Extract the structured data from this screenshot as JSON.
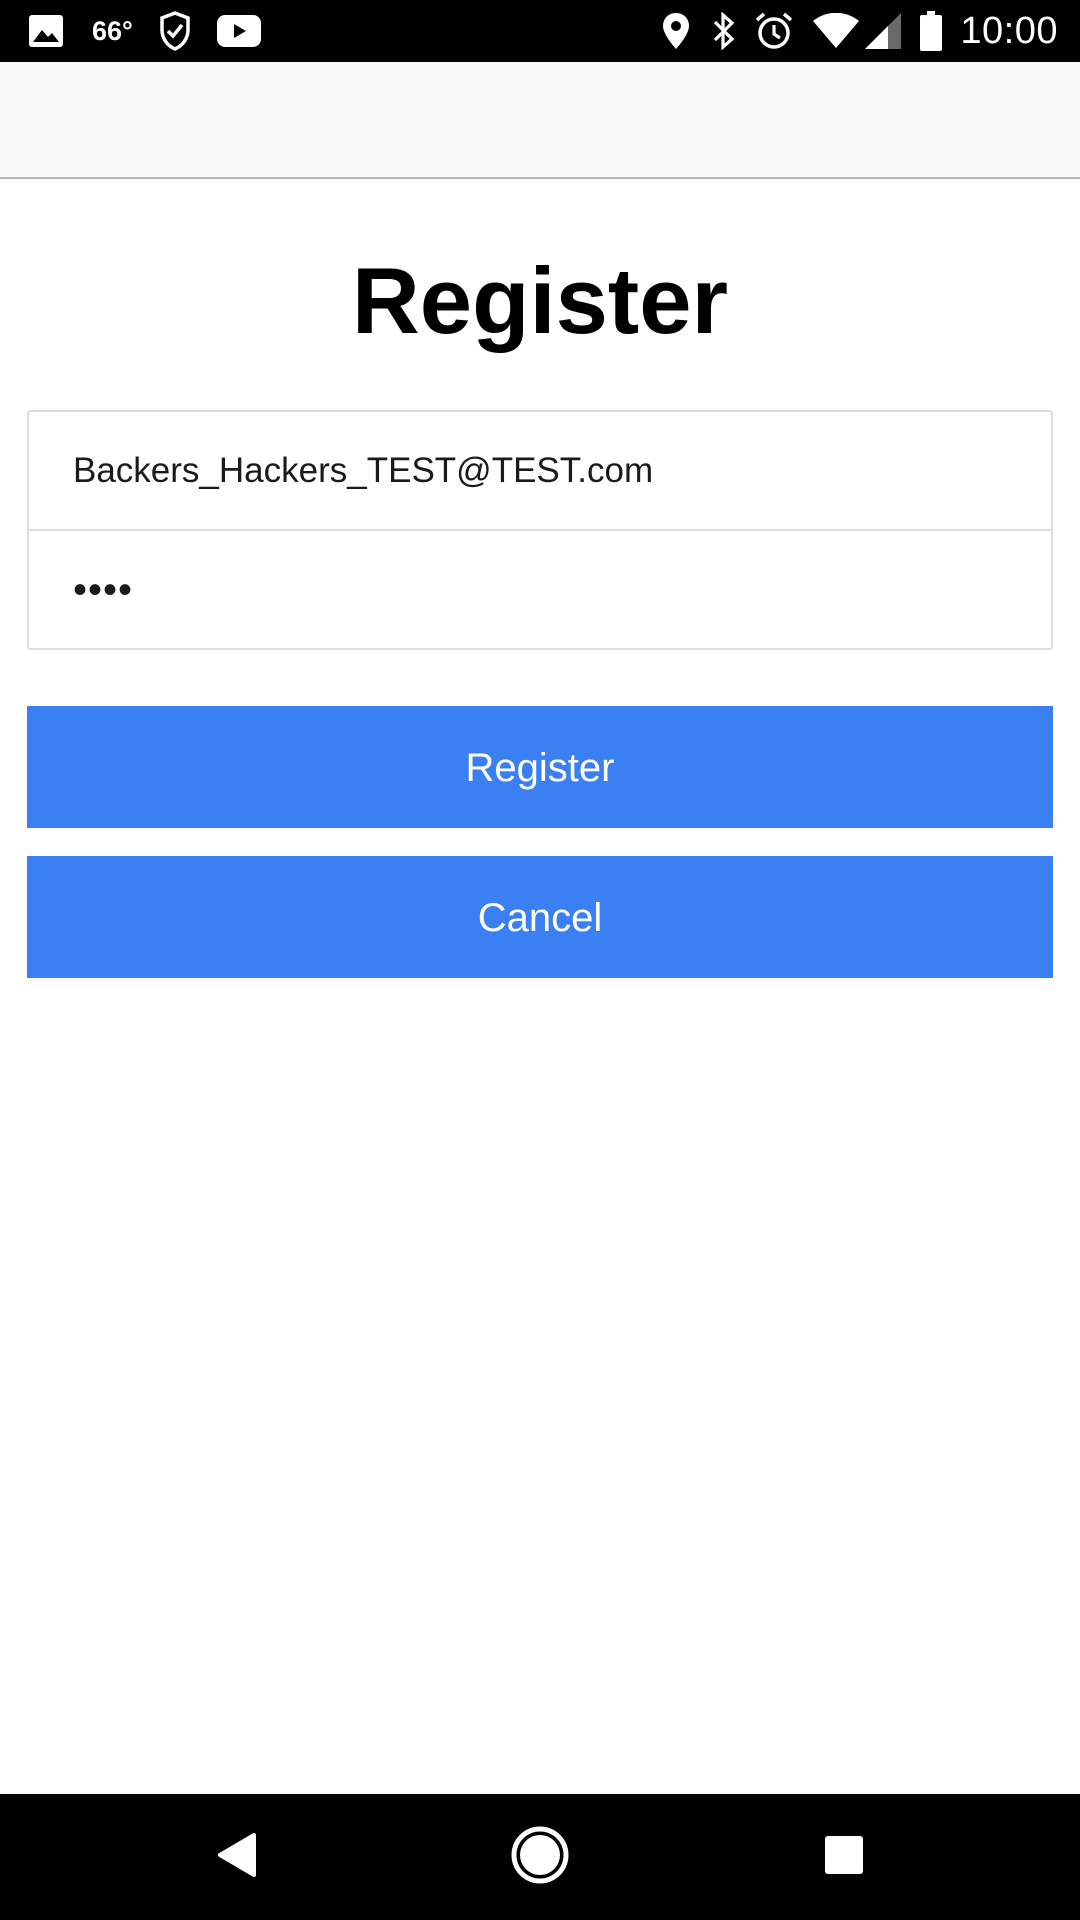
{
  "status_bar": {
    "temperature": "66°",
    "time": "10:00",
    "icons_left": [
      "image-icon",
      "shield-check-icon",
      "youtube-icon"
    ],
    "icons_right": [
      "location-icon",
      "bluetooth-icon",
      "alarm-icon",
      "wifi-icon",
      "signal-icon",
      "battery-icon"
    ]
  },
  "page": {
    "title": "Register"
  },
  "form": {
    "email_value": "Backers_Hackers_TEST@TEST.com",
    "password_value": "••••"
  },
  "buttons": {
    "register_label": "Register",
    "cancel_label": "Cancel"
  },
  "colors": {
    "button_bg": "#3b80f3",
    "button_text": "#ffffff",
    "app_bar_bg": "#f8f8f8",
    "status_bar_bg": "#000000"
  },
  "nav_bar": {
    "icons": [
      "back-icon",
      "home-icon",
      "recents-icon"
    ]
  }
}
